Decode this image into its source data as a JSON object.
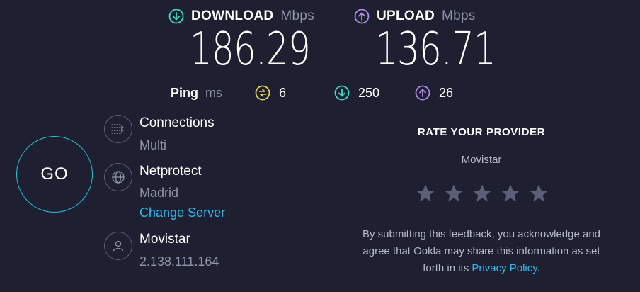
{
  "download": {
    "label": "DOWNLOAD",
    "unit": "Mbps",
    "value": "186.29",
    "icon": "download-arrow-icon",
    "color": "#3fd8c6"
  },
  "upload": {
    "label": "UPLOAD",
    "unit": "Mbps",
    "value": "136.71",
    "icon": "upload-arrow-icon",
    "color": "#b18ae9"
  },
  "ping": {
    "label": "Ping",
    "unit": "ms",
    "idle": "6",
    "download": "250",
    "upload": "26",
    "idle_color": "#ecd35a"
  },
  "go_button": {
    "label": "GO",
    "ring_color": "#20c4d6"
  },
  "connections": {
    "title": "Connections",
    "value": "Multi",
    "icon": "connections-icon"
  },
  "server": {
    "title": "Netprotect",
    "location": "Madrid",
    "change_label": "Change Server",
    "icon": "globe-icon"
  },
  "provider": {
    "title": "Movistar",
    "ip": "2.138.111.164",
    "icon": "user-icon"
  },
  "rate": {
    "title": "RATE YOUR PROVIDER",
    "provider": "Movistar",
    "stars": 5,
    "disclaimer_line1": "By submitting this feedback, you acknowledge and",
    "disclaimer_line2": "agree that Ookla may share this information as set",
    "disclaimer_line3_prefix": "forth in its ",
    "privacy_link": "Privacy Policy",
    "disclaimer_suffix": "."
  },
  "colors": {
    "background": "#1e2032",
    "muted": "#9193a8",
    "link": "#2fb8ef",
    "star": "#5c5f76"
  }
}
